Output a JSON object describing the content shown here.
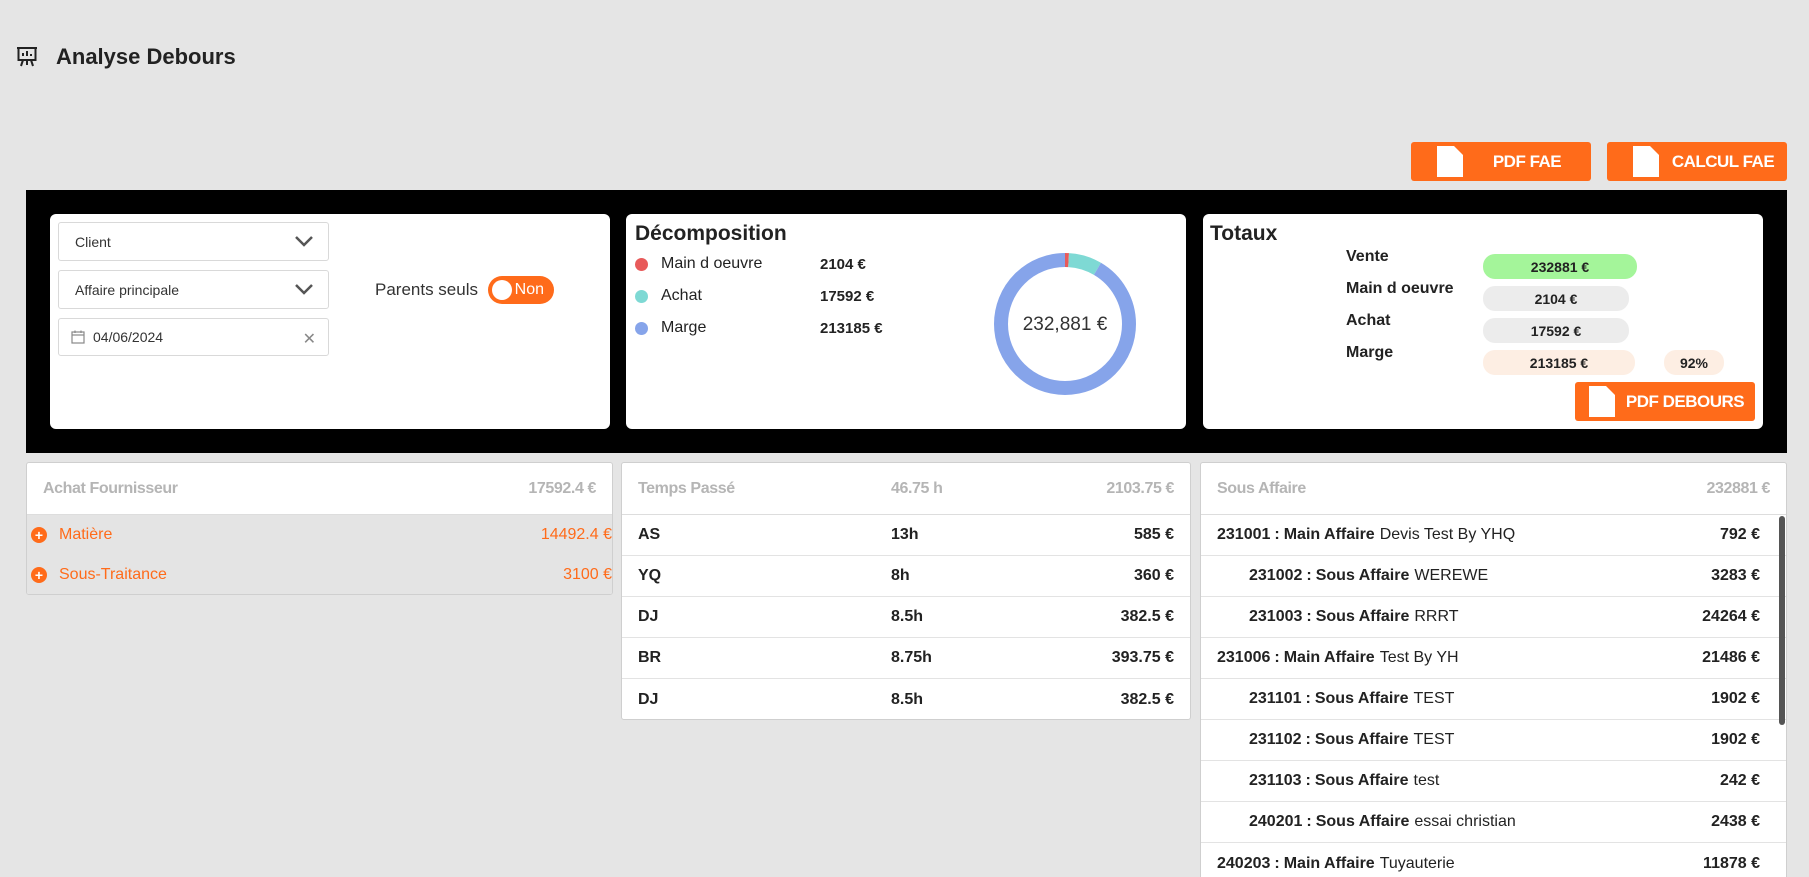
{
  "header": {
    "title": "Analyse Debours",
    "icon": "presentation-chart-icon"
  },
  "actions": {
    "pdf_fae": "PDF FAE",
    "calcul_fae": "CALCUL FAE",
    "pdf_debours": "PDF DEBOURS"
  },
  "filters": {
    "client_placeholder": "Client",
    "affaire_placeholder": "Affaire principale",
    "date_value": "04/06/2024",
    "parents_label": "Parents seuls",
    "parents_toggle": "Non"
  },
  "decomposition": {
    "title": "Décomposition",
    "center_label": "232,881 €",
    "items": [
      {
        "name": "Main d oeuvre",
        "value": "2104 €",
        "color": "#e85a5a",
        "amount": 2104
      },
      {
        "name": "Achat",
        "value": "17592 €",
        "color": "#7ed9d4",
        "amount": 17592
      },
      {
        "name": "Marge",
        "value": "213185 €",
        "color": "#86a4ea",
        "amount": 213185
      }
    ]
  },
  "totaux": {
    "title": "Totaux",
    "vente_label": "Vente",
    "vente_value": "232881 €",
    "mo_label": "Main d oeuvre",
    "mo_value": "2104 €",
    "achat_label": "Achat",
    "achat_value": "17592 €",
    "marge_label": "Marge",
    "marge_value": "213185 €",
    "marge_pct": "92%",
    "colors": {
      "vente": "#a4f59a",
      "neutral": "#ececec",
      "marge": "#fdeee3"
    }
  },
  "achat_fournisseur": {
    "title": "Achat Fournisseur",
    "total": "17592.4 €",
    "rows": [
      {
        "label": "Matière",
        "value": "14492.4 €"
      },
      {
        "label": "Sous-Traitance",
        "value": "3100 €"
      }
    ]
  },
  "temps_passe": {
    "title": "Temps Passé",
    "hours_total": "46.75 h",
    "amount_total": "2103.75 €",
    "rows": [
      {
        "who": "AS",
        "hours": "13h",
        "amount": "585 €"
      },
      {
        "who": "YQ",
        "hours": "8h",
        "amount": "360 €"
      },
      {
        "who": "DJ",
        "hours": "8.5h",
        "amount": "382.5 €"
      },
      {
        "who": "BR",
        "hours": "8.75h",
        "amount": "393.75 €"
      },
      {
        "who": "DJ",
        "hours": "8.5h",
        "amount": "382.5 €"
      }
    ]
  },
  "sous_affaire": {
    "title": "Sous Affaire",
    "total": "232881 €",
    "rows": [
      {
        "code": "231001",
        "kind": "Main Affaire",
        "name": "Devis Test By YHQ",
        "amount": "792 €",
        "child": false
      },
      {
        "code": "231002",
        "kind": "Sous Affaire",
        "name": "WEREWE",
        "amount": "3283 €",
        "child": true
      },
      {
        "code": "231003",
        "kind": "Sous Affaire",
        "name": "RRRT",
        "amount": "24264 €",
        "child": true
      },
      {
        "code": "231006",
        "kind": "Main Affaire",
        "name": "Test By YH",
        "amount": "21486 €",
        "child": false
      },
      {
        "code": "231101",
        "kind": "Sous Affaire",
        "name": "TEST",
        "amount": "1902 €",
        "child": true
      },
      {
        "code": "231102",
        "kind": "Sous Affaire",
        "name": "TEST",
        "amount": "1902 €",
        "child": true
      },
      {
        "code": "231103",
        "kind": "Sous Affaire",
        "name": "test",
        "amount": "242 €",
        "child": true
      },
      {
        "code": "240201",
        "kind": "Sous Affaire",
        "name": "essai christian",
        "amount": "2438 €",
        "child": true
      },
      {
        "code": "240203",
        "kind": "Main Affaire",
        "name": "Tuyauterie",
        "amount": "11878 €",
        "child": false
      }
    ],
    "sep": ":"
  }
}
